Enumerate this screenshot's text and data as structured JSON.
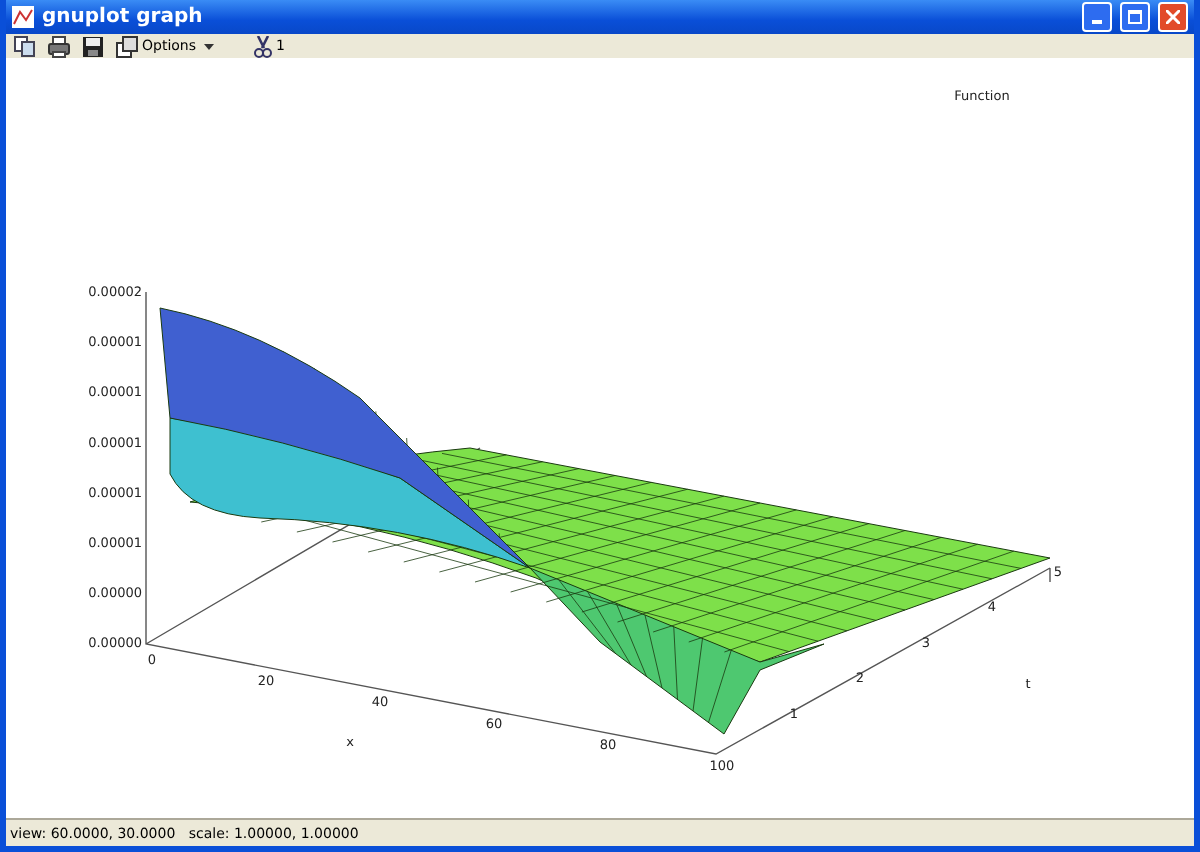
{
  "window": {
    "title": "gnuplot graph"
  },
  "toolbar": [
    {
      "kind": "copy"
    },
    {
      "kind": "print"
    },
    {
      "kind": "save"
    },
    {
      "kind": "options",
      "label": "Options"
    },
    {
      "kind": "replot",
      "label": "1"
    }
  ],
  "plot": {
    "key_title": "Function",
    "z_ticks": [
      "0.00002",
      "0.00001",
      "0.00001",
      "0.00001",
      "0.00001",
      "0.00001",
      "0.00000",
      "0.00000"
    ],
    "x_ticks": [
      "0",
      "20",
      "40",
      "60",
      "80",
      "100"
    ],
    "t_ticks": [
      "1",
      "2",
      "3",
      "4",
      "5"
    ],
    "xlabel": "x",
    "tlabel": "t"
  },
  "status_bar": {
    "text": "view: 60.0000, 30.0000   scale: 1.00000, 1.00000"
  }
}
